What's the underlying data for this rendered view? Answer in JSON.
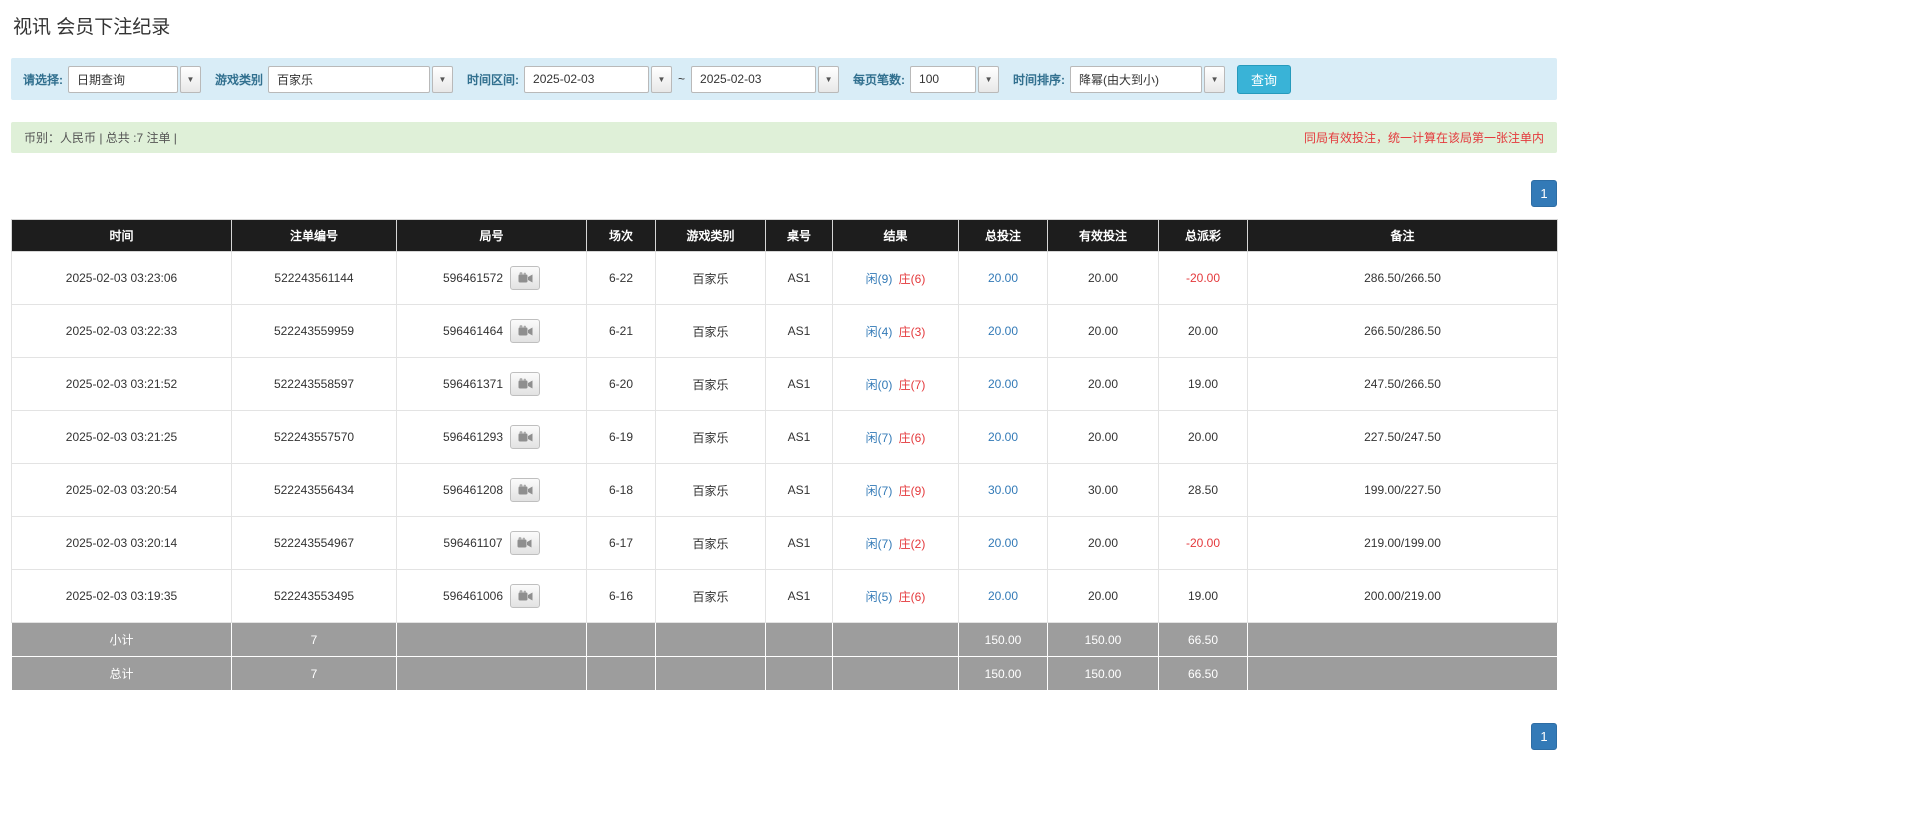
{
  "page": {
    "title": "视讯 会员下注纪录"
  },
  "filters": {
    "select_label": "请选择:",
    "select_value": "日期查询",
    "game_type_label": "游戏类别",
    "game_type_value": "百家乐",
    "date_range_label": "时间区间:",
    "date_from": "2025-02-03",
    "date_separator": "~",
    "date_to": "2025-02-03",
    "page_size_label": "每页笔数:",
    "page_size_value": "100",
    "sort_label": "时间排序:",
    "sort_value": "降幂(由大到小)",
    "search_button": "查询",
    "dropdown_arrow": "▼"
  },
  "summary": {
    "left": "币别：人民币 | 总共 :7 注单 |",
    "right": "同局有效投注，统一计算在该局第一张注单内"
  },
  "pagination": {
    "page": "1"
  },
  "table": {
    "headers": [
      "时间",
      "注单编号",
      "局号",
      "场次",
      "游戏类别",
      "桌号",
      "结果",
      "总投注",
      "有效投注",
      "总派彩",
      "备注"
    ],
    "rows": [
      {
        "time": "2025-02-03 03:23:06",
        "bet_id": "522243561144",
        "round_id": "596461572",
        "session": "6-22",
        "game": "百家乐",
        "table_no": "AS1",
        "result_player": "闲(9)",
        "result_banker": "庄(6)",
        "total_bet": "20.00",
        "valid_bet": "20.00",
        "payout": "-20.00",
        "note": "286.50/266.50"
      },
      {
        "time": "2025-02-03 03:22:33",
        "bet_id": "522243559959",
        "round_id": "596461464",
        "session": "6-21",
        "game": "百家乐",
        "table_no": "AS1",
        "result_player": "闲(4)",
        "result_banker": "庄(3)",
        "total_bet": "20.00",
        "valid_bet": "20.00",
        "payout": "20.00",
        "note": "266.50/286.50"
      },
      {
        "time": "2025-02-03 03:21:52",
        "bet_id": "522243558597",
        "round_id": "596461371",
        "session": "6-20",
        "game": "百家乐",
        "table_no": "AS1",
        "result_player": "闲(0)",
        "result_banker": "庄(7)",
        "total_bet": "20.00",
        "valid_bet": "20.00",
        "payout": "19.00",
        "note": "247.50/266.50"
      },
      {
        "time": "2025-02-03 03:21:25",
        "bet_id": "522243557570",
        "round_id": "596461293",
        "session": "6-19",
        "game": "百家乐",
        "table_no": "AS1",
        "result_player": "闲(7)",
        "result_banker": "庄(6)",
        "total_bet": "20.00",
        "valid_bet": "20.00",
        "payout": "20.00",
        "note": "227.50/247.50"
      },
      {
        "time": "2025-02-03 03:20:54",
        "bet_id": "522243556434",
        "round_id": "596461208",
        "session": "6-18",
        "game": "百家乐",
        "table_no": "AS1",
        "result_player": "闲(7)",
        "result_banker": "庄(9)",
        "total_bet": "30.00",
        "valid_bet": "30.00",
        "payout": "28.50",
        "note": "199.00/227.50"
      },
      {
        "time": "2025-02-03 03:20:14",
        "bet_id": "522243554967",
        "round_id": "596461107",
        "session": "6-17",
        "game": "百家乐",
        "table_no": "AS1",
        "result_player": "闲(7)",
        "result_banker": "庄(2)",
        "total_bet": "20.00",
        "valid_bet": "20.00",
        "payout": "-20.00",
        "note": "219.00/199.00"
      },
      {
        "time": "2025-02-03 03:19:35",
        "bet_id": "522243553495",
        "round_id": "596461006",
        "session": "6-16",
        "game": "百家乐",
        "table_no": "AS1",
        "result_player": "闲(5)",
        "result_banker": "庄(6)",
        "total_bet": "20.00",
        "valid_bet": "20.00",
        "payout": "19.00",
        "note": "200.00/219.00"
      }
    ],
    "subtotal": {
      "label": "小计",
      "count": "7",
      "total_bet": "150.00",
      "valid_bet": "150.00",
      "payout": "66.50"
    },
    "total": {
      "label": "总计",
      "count": "7",
      "total_bet": "150.00",
      "valid_bet": "150.00",
      "payout": "66.50"
    }
  },
  "colors": {
    "filter_bar_bg": "#d9edf7",
    "summary_bar_bg": "#dff0d8",
    "summary_warning_red": "#e4393c",
    "table_header_bg": "#1d1d1d",
    "footer_row_bg": "#9d9d9d",
    "link_blue": "#337ab7",
    "negative_red": "#e4393c",
    "player_blue": "#337ab7",
    "banker_red": "#e4393c",
    "search_button_bg": "#39b3d7",
    "pager_bg": "#337ab7"
  }
}
